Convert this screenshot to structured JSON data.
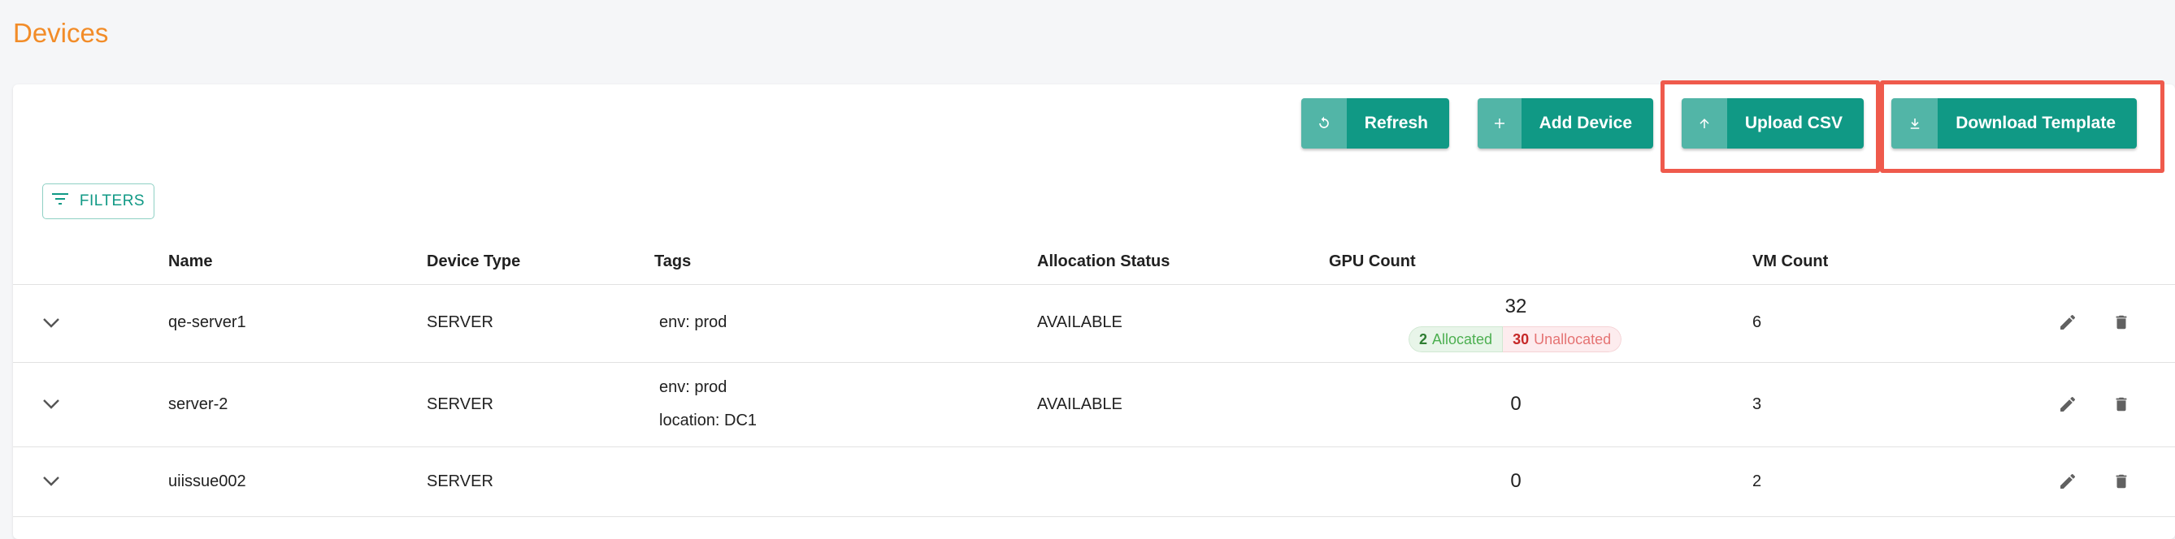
{
  "page": {
    "title": "Devices"
  },
  "toolbar": {
    "refresh_label": "Refresh",
    "add_device_label": "Add Device",
    "upload_csv_label": "Upload CSV",
    "download_template_label": "Download Template",
    "filters_label": "FILTERS"
  },
  "table": {
    "headers": {
      "name": "Name",
      "device_type": "Device Type",
      "tags": "Tags",
      "allocation_status": "Allocation Status",
      "gpu_count": "GPU Count",
      "vm_count": "VM Count"
    },
    "rows": [
      {
        "name": "qe-server1",
        "device_type": "SERVER",
        "tags": [
          "env: prod"
        ],
        "allocation_status": "AVAILABLE",
        "gpu_count": "32",
        "gpu_allocated": "2",
        "gpu_allocated_label": "Allocated",
        "gpu_unallocated": "30",
        "gpu_unallocated_label": "Unallocated",
        "vm_count": "6"
      },
      {
        "name": "server-2",
        "device_type": "SERVER",
        "tags": [
          "env: prod",
          "location: DC1"
        ],
        "allocation_status": "AVAILABLE",
        "gpu_count": "0",
        "vm_count": "3"
      },
      {
        "name": "uiissue002",
        "device_type": "SERVER",
        "tags": [],
        "allocation_status": "",
        "gpu_count": "0",
        "vm_count": "2"
      }
    ]
  },
  "icons": {
    "refresh": "refresh-icon",
    "add": "plus-icon",
    "upload": "arrow-up-icon",
    "download": "download-icon",
    "filter": "filter-icon",
    "expand": "chevron-down-icon",
    "edit": "pencil-icon",
    "delete": "trash-icon"
  },
  "colors": {
    "title": "#f28c28",
    "primary": "#109985",
    "highlight": "#ef5a4c",
    "allocated": "#2e7d32",
    "unallocated": "#c62828"
  }
}
